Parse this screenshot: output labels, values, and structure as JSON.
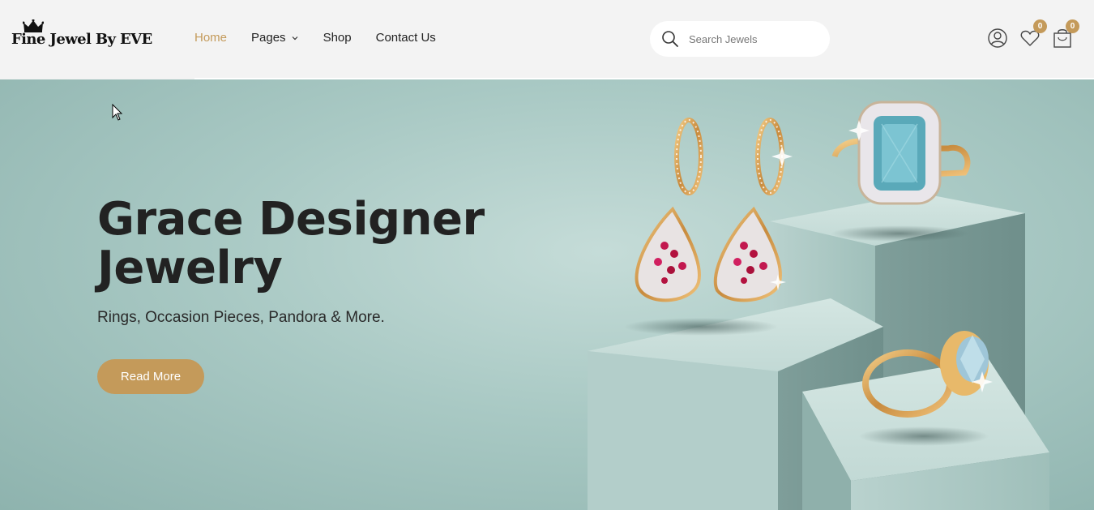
{
  "brand": {
    "name": "Fine Jewel By EVE",
    "logo_icon": "crown-icon"
  },
  "nav": {
    "items": [
      {
        "label": "Home",
        "active": true
      },
      {
        "label": "Pages",
        "active": false,
        "has_dropdown": true
      },
      {
        "label": "Shop",
        "active": false
      },
      {
        "label": "Contact Us",
        "active": false
      }
    ]
  },
  "search": {
    "placeholder": "Search Jewels",
    "value": "",
    "icon": "search-icon"
  },
  "header_actions": {
    "account_icon": "user-icon",
    "wishlist": {
      "icon": "heart-icon",
      "count": "0"
    },
    "cart": {
      "icon": "shopping-bag-icon",
      "count": "0"
    }
  },
  "hero": {
    "title_line1": "Grace Designer",
    "title_line2": "Jewelry",
    "subtitle": "Rings, Occasion Pieces, Pandora & More.",
    "cta_label": "Read More"
  },
  "colors": {
    "accent": "#c49a5a",
    "header_bg": "#f3f3f3",
    "hero_bg": "#a9c9c4",
    "text": "#222222"
  }
}
